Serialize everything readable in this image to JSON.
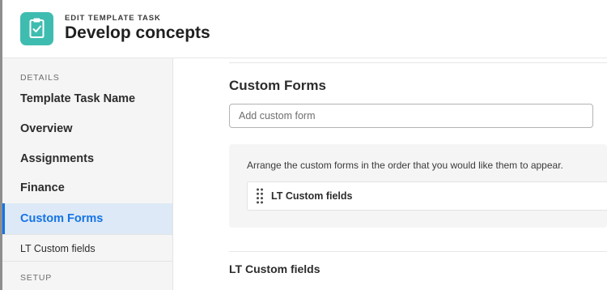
{
  "header": {
    "subtitle": "EDIT TEMPLATE TASK",
    "title": "Develop concepts",
    "icon": "clipboard-check-icon",
    "icon_color": "#3fbcb0"
  },
  "sidebar": {
    "section_details": "DETAILS",
    "items": [
      {
        "label": "Template Task Name"
      },
      {
        "label": "Overview"
      },
      {
        "label": "Assignments"
      },
      {
        "label": "Finance"
      },
      {
        "label": "Custom Forms",
        "active": true
      }
    ],
    "sub_item": "LT Custom fields",
    "section_setup": "SETUP",
    "active_color": "#1473e6"
  },
  "main": {
    "title": "Custom Forms",
    "add_placeholder": "Add custom form",
    "arrange_hint": "Arrange the custom forms in the order that you would like them to appear.",
    "forms": [
      {
        "label": "LT Custom fields",
        "icon": "drag-handle-icon"
      }
    ],
    "section_title": "LT Custom fields"
  }
}
